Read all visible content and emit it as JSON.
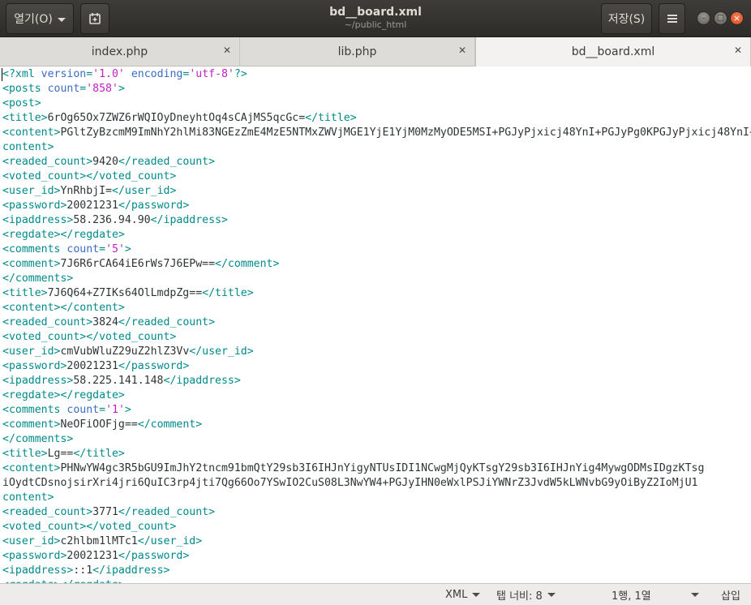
{
  "header": {
    "open_label": "열기(O)",
    "save_label": "저장(S)",
    "title": "bd__board.xml",
    "subtitle": "~/public_html",
    "menu_icon": "hamburger-icon",
    "new_icon": "new-document-icon"
  },
  "tabs": [
    {
      "label": "index.php",
      "active": false
    },
    {
      "label": "lib.php",
      "active": false
    },
    {
      "label": "bd__board.xml",
      "active": true
    }
  ],
  "colors": {
    "tag": "#008a8a",
    "attribute": "#3a6cc4",
    "string": "#c21fc2",
    "text": "#2e3436"
  },
  "editor": {
    "lines": [
      [
        [
          "tag",
          "<?xml "
        ],
        [
          "attr",
          "version"
        ],
        [
          "tag",
          "="
        ],
        [
          "str",
          "'1.0'"
        ],
        [
          "tag",
          " "
        ],
        [
          "attr",
          "encoding"
        ],
        [
          "tag",
          "="
        ],
        [
          "str",
          "'utf-8'"
        ],
        [
          "tag",
          "?>"
        ]
      ],
      [
        [
          "tag",
          "<posts "
        ],
        [
          "attr",
          "count"
        ],
        [
          "tag",
          "="
        ],
        [
          "str",
          "'858'"
        ],
        [
          "tag",
          ">"
        ]
      ],
      [
        [
          "tag",
          "<post>"
        ]
      ],
      [
        [
          "tag",
          "<title>"
        ],
        [
          "txt",
          "6rOg65Ox7ZWZ6rWQIOyDneyhtOq4sCAjMS5qcGc="
        ],
        [
          "tag",
          "</title>"
        ]
      ],
      [
        [
          "tag",
          "<content>"
        ],
        [
          "txt",
          "PGltZyBzcmM9ImNhY2hlMi83NGEzZmE4MzE5NTMxZWVjMGE1YjE1YjM0MzMyODE5MSI+PGJyPjxicj48YnI+PGJyPg0KPGJyPjxicj48YnI+"
        ]
      ],
      [
        [
          "tag",
          "content>"
        ]
      ],
      [
        [
          "tag",
          "<readed_count>"
        ],
        [
          "txt",
          "9420"
        ],
        [
          "tag",
          "</readed_count>"
        ]
      ],
      [
        [
          "tag",
          "<voted_count></voted_count>"
        ]
      ],
      [
        [
          "tag",
          "<user_id>"
        ],
        [
          "txt",
          "YnRhbjI="
        ],
        [
          "tag",
          "</user_id>"
        ]
      ],
      [
        [
          "tag",
          "<password>"
        ],
        [
          "txt",
          "20021231"
        ],
        [
          "tag",
          "</password>"
        ]
      ],
      [
        [
          "tag",
          "<ipaddress>"
        ],
        [
          "txt",
          "58.236.94.90"
        ],
        [
          "tag",
          "</ipaddress>"
        ]
      ],
      [
        [
          "tag",
          "<regdate></regdate>"
        ]
      ],
      [
        [
          "tag",
          "<comments "
        ],
        [
          "attr",
          "count"
        ],
        [
          "tag",
          "="
        ],
        [
          "str",
          "'5'"
        ],
        [
          "tag",
          ">"
        ]
      ],
      [
        [
          "tag",
          "<comment>"
        ],
        [
          "txt",
          "7J6R6rCA64iE6rWs7J6EPw=="
        ],
        [
          "tag",
          "</comment>"
        ]
      ],
      [
        [
          "tag",
          "</comments>"
        ]
      ],
      [
        [
          "tag",
          "<title>"
        ],
        [
          "txt",
          "7J6Q64+Z7IKs64OlLmdpZg=="
        ],
        [
          "tag",
          "</title>"
        ]
      ],
      [
        [
          "tag",
          "<content></content>"
        ]
      ],
      [
        [
          "tag",
          "<readed_count>"
        ],
        [
          "txt",
          "3824"
        ],
        [
          "tag",
          "</readed_count>"
        ]
      ],
      [
        [
          "tag",
          "<voted_count></voted_count>"
        ]
      ],
      [
        [
          "tag",
          "<user_id>"
        ],
        [
          "txt",
          "cmVubWluZ29uZ2hlZ3Vv"
        ],
        [
          "tag",
          "</user_id>"
        ]
      ],
      [
        [
          "tag",
          "<password>"
        ],
        [
          "txt",
          "20021231"
        ],
        [
          "tag",
          "</password>"
        ]
      ],
      [
        [
          "tag",
          "<ipaddress>"
        ],
        [
          "txt",
          "58.225.141.148"
        ],
        [
          "tag",
          "</ipaddress>"
        ]
      ],
      [
        [
          "tag",
          "<regdate></regdate>"
        ]
      ],
      [
        [
          "tag",
          "<comments "
        ],
        [
          "attr",
          "count"
        ],
        [
          "tag",
          "="
        ],
        [
          "str",
          "'1'"
        ],
        [
          "tag",
          ">"
        ]
      ],
      [
        [
          "tag",
          "<comment>"
        ],
        [
          "txt",
          "NeOFiOOFjg=="
        ],
        [
          "tag",
          "</comment>"
        ]
      ],
      [
        [
          "tag",
          "</comments>"
        ]
      ],
      [
        [
          "tag",
          "<title>"
        ],
        [
          "txt",
          "Lg=="
        ],
        [
          "tag",
          "</title>"
        ]
      ],
      [
        [
          "tag",
          "<content>"
        ],
        [
          "txt",
          "PHNwYW4gc3R5bGU9ImJhY2tncm91bmQtY29sb3I6IHJnYigyNTUsIDI1NCwgMjQyKTsgY29sb3I6IHJnYig4MywgODMsIDgzKTsg"
        ]
      ],
      [
        [
          "txt",
          "iOydtCDsnojsirXri4jri6QuIC3rp4jti7Qg66Oo7YSwIO2CuS08L3NwYW4+PGJyIHN0eWxlPSJiYWNrZ3JvdW5kLWNvbG9yOiByZ2IoMjU1"
        ]
      ],
      [
        [
          "tag",
          "content>"
        ]
      ],
      [
        [
          "tag",
          "<readed_count>"
        ],
        [
          "txt",
          "3771"
        ],
        [
          "tag",
          "</readed_count>"
        ]
      ],
      [
        [
          "tag",
          "<voted_count></voted_count>"
        ]
      ],
      [
        [
          "tag",
          "<user_id>"
        ],
        [
          "txt",
          "c2hlbm1lMTc1"
        ],
        [
          "tag",
          "</user_id>"
        ]
      ],
      [
        [
          "tag",
          "<password>"
        ],
        [
          "txt",
          "20021231"
        ],
        [
          "tag",
          "</password>"
        ]
      ],
      [
        [
          "tag",
          "<ipaddress>"
        ],
        [
          "txt",
          "::1"
        ],
        [
          "tag",
          "</ipaddress>"
        ]
      ],
      [
        [
          "tag",
          "<regdate></regdate>"
        ]
      ]
    ]
  },
  "status": {
    "language": "XML",
    "tab_width": "탭 너비: 8",
    "position": "1행, 1열",
    "mode": "삽입"
  }
}
